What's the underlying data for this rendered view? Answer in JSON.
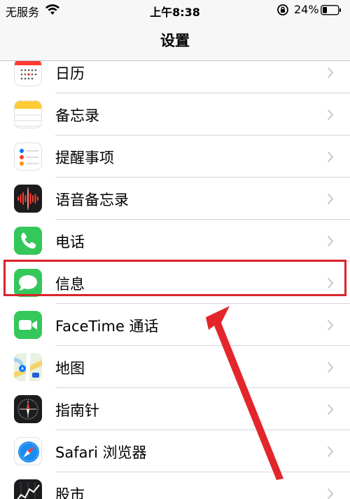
{
  "status_bar": {
    "carrier": "无服务",
    "time": "上午8:38",
    "battery": "24%"
  },
  "nav": {
    "title": "设置"
  },
  "items": [
    {
      "label": "日历",
      "icon": "calendar-icon"
    },
    {
      "label": "备忘录",
      "icon": "notes-icon"
    },
    {
      "label": "提醒事项",
      "icon": "reminders-icon"
    },
    {
      "label": "语音备忘录",
      "icon": "voice-memos-icon"
    },
    {
      "label": "电话",
      "icon": "phone-icon"
    },
    {
      "label": "信息",
      "icon": "messages-icon"
    },
    {
      "label": "FaceTime 通话",
      "icon": "facetime-icon"
    },
    {
      "label": "地图",
      "icon": "maps-icon"
    },
    {
      "label": "指南针",
      "icon": "compass-icon"
    },
    {
      "label": "Safari 浏览器",
      "icon": "safari-icon"
    },
    {
      "label": "股市",
      "icon": "stocks-icon"
    }
  ],
  "highlight": {
    "target": "信息",
    "color": "#d9252b"
  },
  "colors": {
    "phone_green": "#34c759",
    "messages_green": "#34c759",
    "voice_memos_red": "#ff3b30",
    "chevron": "#c7c7cc"
  }
}
